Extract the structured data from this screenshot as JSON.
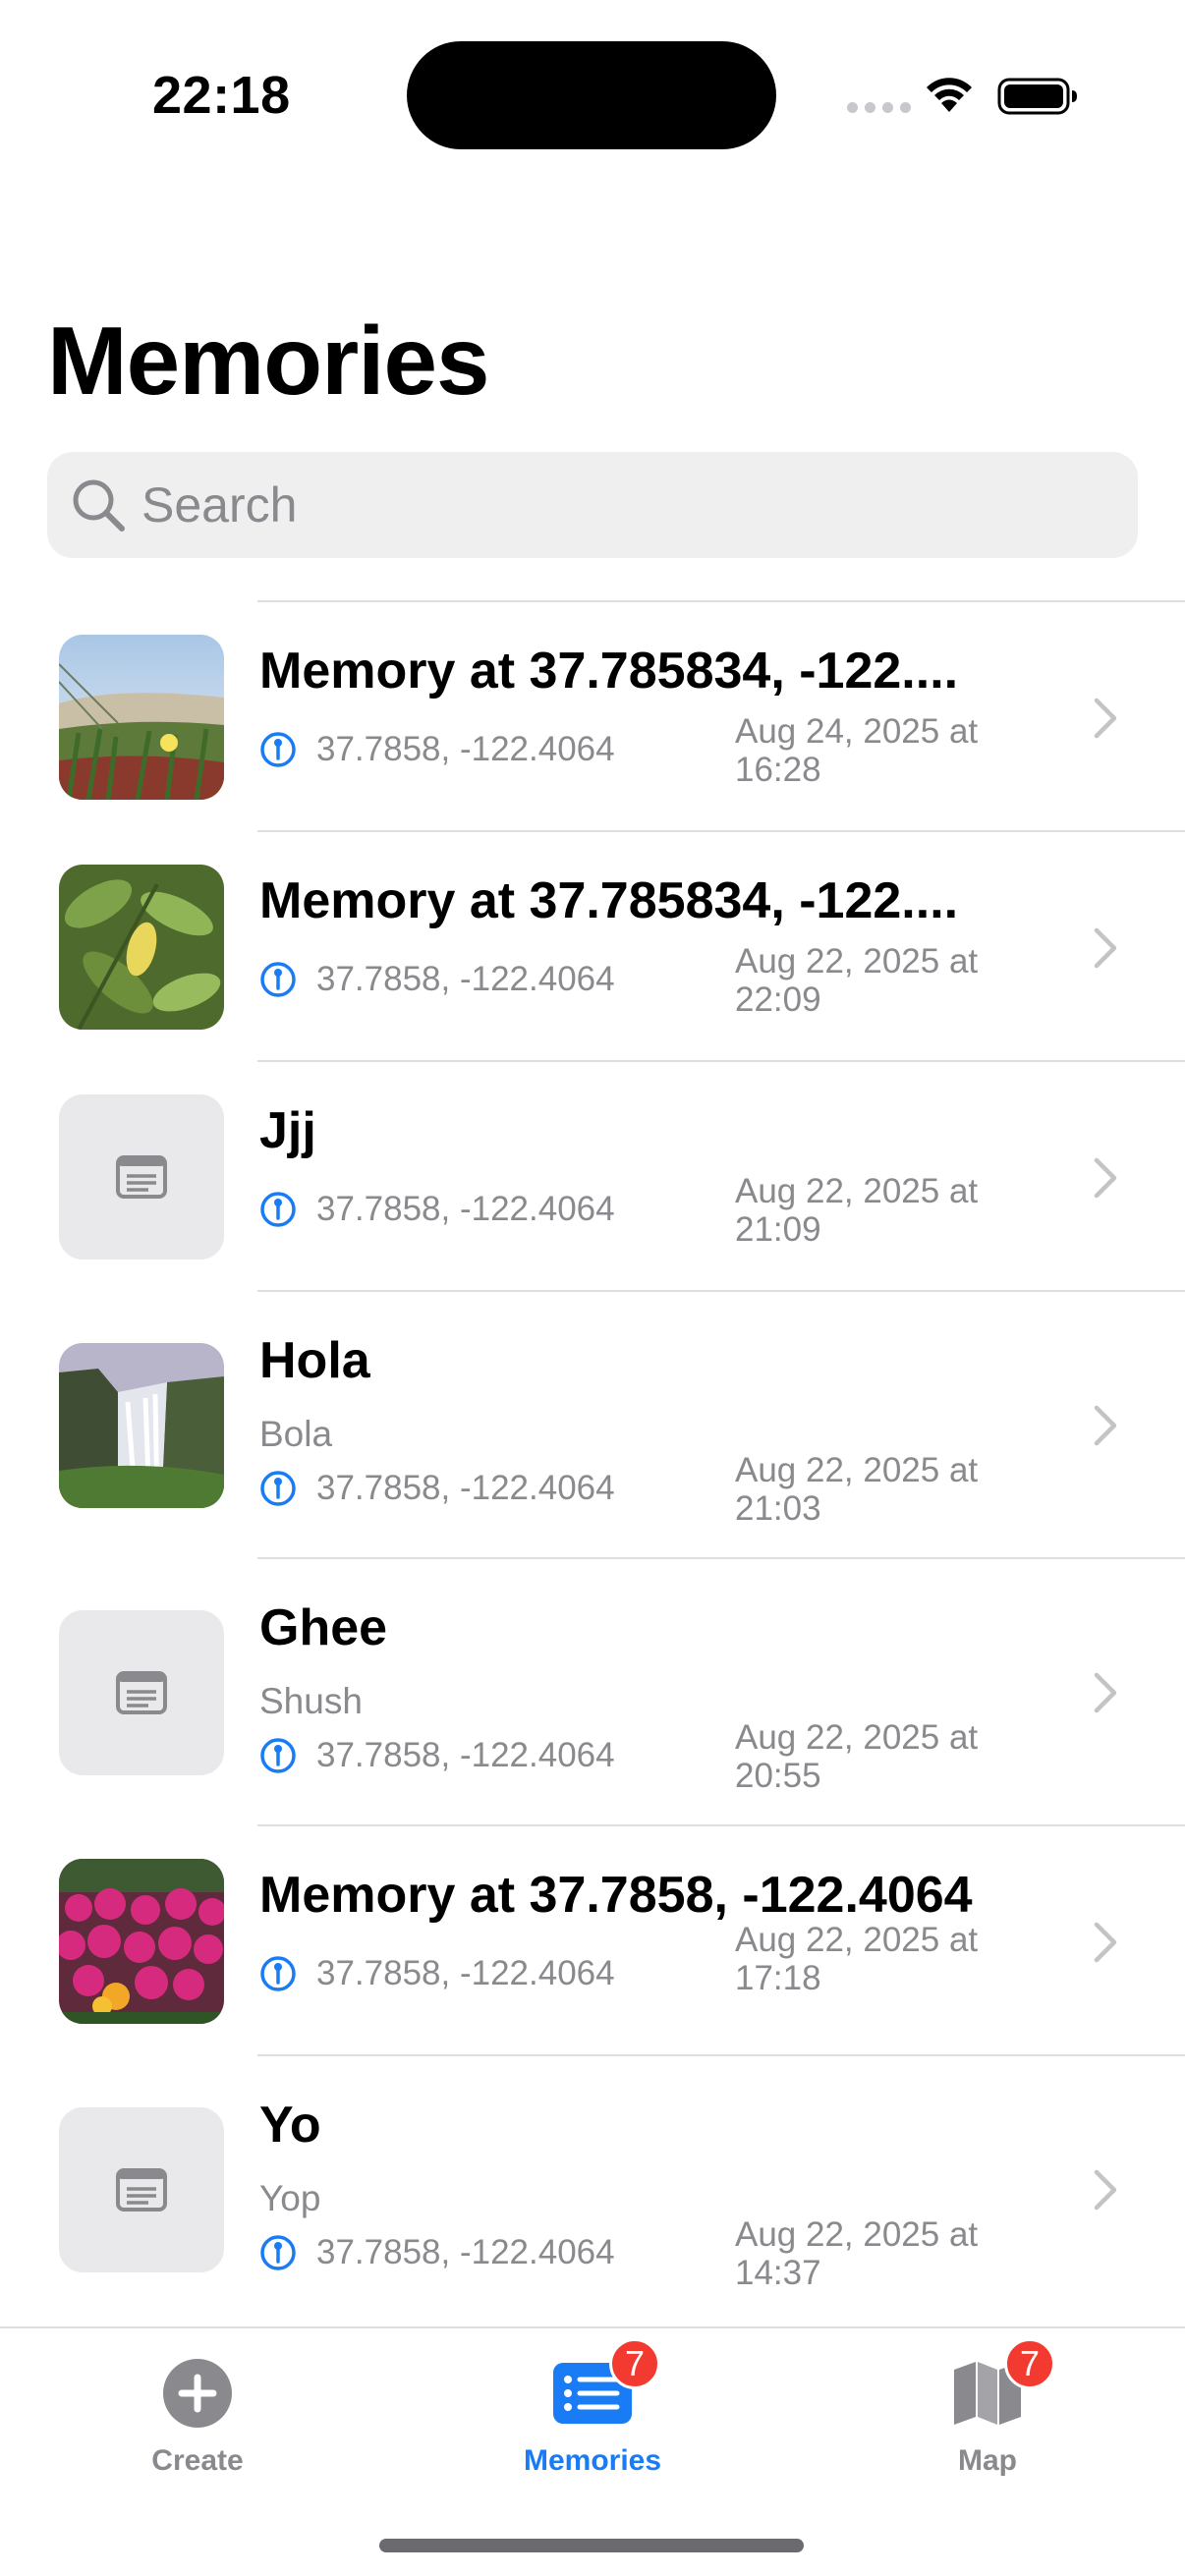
{
  "status_bar": {
    "time": "22:18"
  },
  "page": {
    "title": "Memories"
  },
  "search": {
    "placeholder": "Search"
  },
  "memories": [
    {
      "title": "Memory at 37.785834, -122....",
      "subtitle": "",
      "coords": "37.7858, -122.4064",
      "date": "Aug 24, 2025 at 16:28",
      "thumbnail": "grass-dune-photo"
    },
    {
      "title": "Memory at 37.785834, -122....",
      "subtitle": "",
      "coords": "37.7858, -122.4064",
      "date": "Aug 22, 2025 at 22:09",
      "thumbnail": "green-leaves-photo"
    },
    {
      "title": "Jjj",
      "subtitle": "",
      "coords": "37.7858, -122.4064",
      "date": "Aug 22, 2025 at 21:09",
      "thumbnail": "note-placeholder-icon"
    },
    {
      "title": "Hola",
      "subtitle": "Bola",
      "coords": "37.7858, -122.4064",
      "date": "Aug 22, 2025 at 21:03",
      "thumbnail": "waterfall-photo"
    },
    {
      "title": "Ghee",
      "subtitle": "Shush",
      "coords": "37.7858, -122.4064",
      "date": "Aug 22, 2025 at 20:55",
      "thumbnail": "note-placeholder-icon"
    },
    {
      "title": "Memory at 37.7858, -122.4064",
      "subtitle": "",
      "coords": "37.7858, -122.4064",
      "date": "Aug 22, 2025 at 17:18",
      "thumbnail": "pink-flowers-photo"
    },
    {
      "title": "Yo",
      "subtitle": "Yop",
      "coords": "37.7858, -122.4064",
      "date": "Aug 22, 2025 at 14:37",
      "thumbnail": "note-placeholder-icon"
    }
  ],
  "tab_bar": {
    "create": {
      "label": "Create",
      "icon": "plus-circle-icon"
    },
    "memories": {
      "label": "Memories",
      "icon": "list-icon",
      "badge": "7",
      "active": true
    },
    "map": {
      "label": "Map",
      "icon": "map-icon",
      "badge": "7"
    }
  },
  "colors": {
    "accent": "#1a7cf5",
    "badge": "#f23a30",
    "secondary_text": "#8a8a8e",
    "search_bg": "#efeff0",
    "placeholder_bg": "#e9e9eb"
  }
}
